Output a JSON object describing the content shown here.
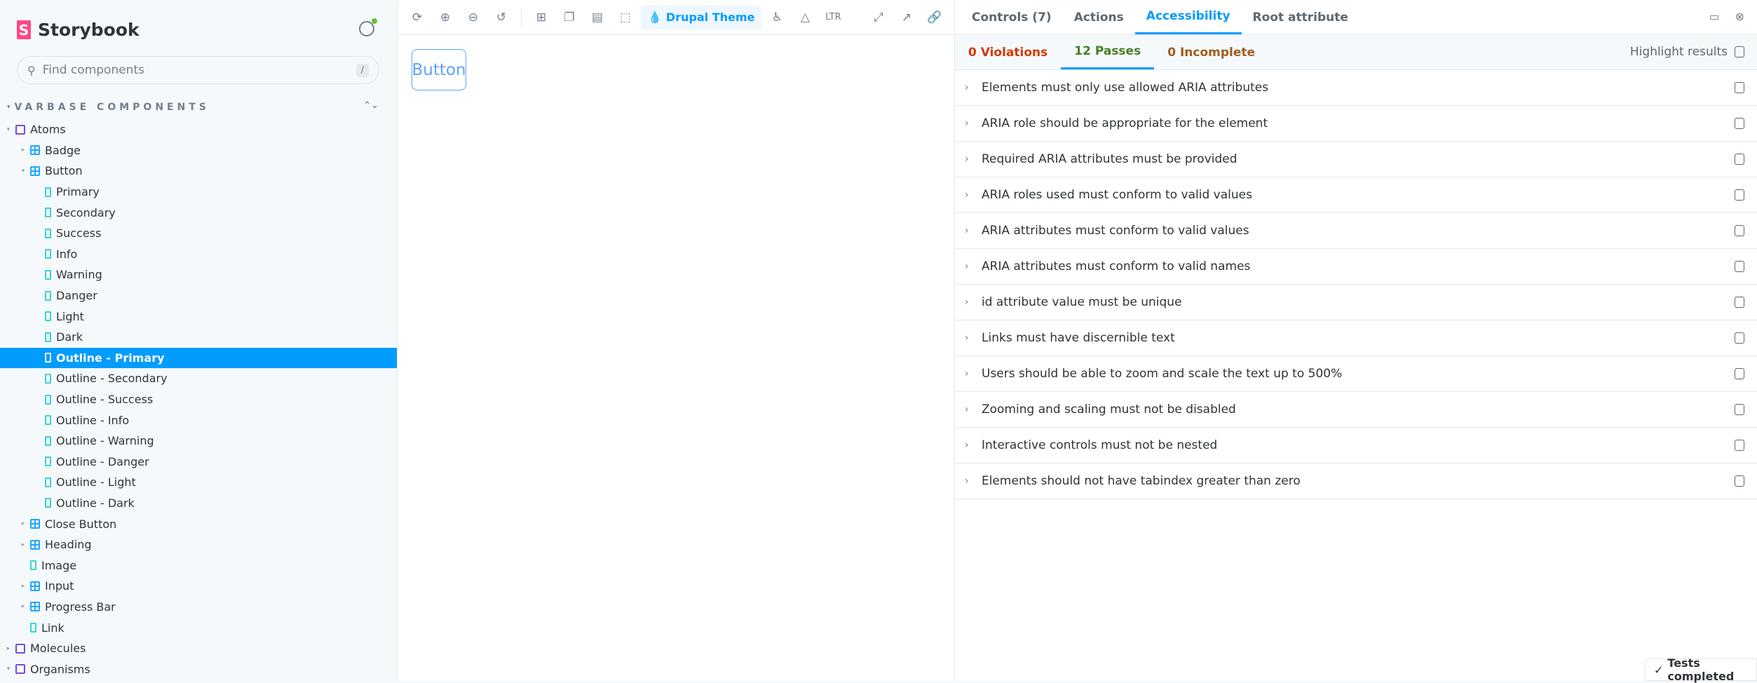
{
  "sidebar": {
    "brand": "Storybook",
    "search_placeholder": "Find components",
    "search_shortcut": "/",
    "section": "VARBASE COMPONENTS",
    "items": [
      {
        "label": "Atoms",
        "type": "folder",
        "level": 0,
        "caret": "▾"
      },
      {
        "label": "Badge",
        "type": "comp",
        "level": 1,
        "caret": "▸"
      },
      {
        "label": "Button",
        "type": "comp",
        "level": 1,
        "caret": "▾"
      },
      {
        "label": "Primary",
        "type": "story",
        "level": 2
      },
      {
        "label": "Secondary",
        "type": "story",
        "level": 2
      },
      {
        "label": "Success",
        "type": "story",
        "level": 2
      },
      {
        "label": "Info",
        "type": "story",
        "level": 2
      },
      {
        "label": "Warning",
        "type": "story",
        "level": 2
      },
      {
        "label": "Danger",
        "type": "story",
        "level": 2
      },
      {
        "label": "Light",
        "type": "story",
        "level": 2
      },
      {
        "label": "Dark",
        "type": "story",
        "level": 2
      },
      {
        "label": "Outline - Primary",
        "type": "story",
        "level": 2,
        "selected": true
      },
      {
        "label": "Outline - Secondary",
        "type": "story",
        "level": 2
      },
      {
        "label": "Outline - Success",
        "type": "story",
        "level": 2
      },
      {
        "label": "Outline - Info",
        "type": "story",
        "level": 2
      },
      {
        "label": "Outline - Warning",
        "type": "story",
        "level": 2
      },
      {
        "label": "Outline - Danger",
        "type": "story",
        "level": 2
      },
      {
        "label": "Outline - Light",
        "type": "story",
        "level": 2
      },
      {
        "label": "Outline - Dark",
        "type": "story",
        "level": 2
      },
      {
        "label": "Close Button",
        "type": "comp",
        "level": 1,
        "caret": "▸"
      },
      {
        "label": "Heading",
        "type": "comp",
        "level": 1,
        "caret": "▸"
      },
      {
        "label": "Image",
        "type": "story",
        "level": 1
      },
      {
        "label": "Input",
        "type": "comp",
        "level": 1,
        "caret": "▸"
      },
      {
        "label": "Progress Bar",
        "type": "comp",
        "level": 1,
        "caret": "▸"
      },
      {
        "label": "Link",
        "type": "story",
        "level": 1
      },
      {
        "label": "Molecules",
        "type": "folder",
        "level": 0,
        "caret": "▸"
      },
      {
        "label": "Organisms",
        "type": "folder",
        "level": 0,
        "caret": "▾"
      }
    ]
  },
  "toolbar": {
    "theme_label": "Drupal Theme",
    "direction": "LTR"
  },
  "preview": {
    "button_label": "Button"
  },
  "panel": {
    "tabs": [
      "Controls (7)",
      "Actions",
      "Accessibility",
      "Root attribute"
    ],
    "subtabs": [
      {
        "label": "0 Violations",
        "color": "#d43900"
      },
      {
        "label": "12 Passes",
        "color": "#448028"
      },
      {
        "label": "0 Incomplete",
        "color": "#a15c20"
      }
    ],
    "highlight_label": "Highlight results",
    "rules": [
      "Elements must only use allowed ARIA attributes",
      "ARIA role should be appropriate for the element",
      "Required ARIA attributes must be provided",
      "ARIA roles used must conform to valid values",
      "ARIA attributes must conform to valid values",
      "ARIA attributes must conform to valid names",
      "id attribute value must be unique",
      "Links must have discernible text",
      "Users should be able to zoom and scale the text up to 500%",
      "Zooming and scaling must not be disabled",
      "Interactive controls must not be nested",
      "Elements should not have tabindex greater than zero"
    ],
    "status": "Tests completed"
  }
}
